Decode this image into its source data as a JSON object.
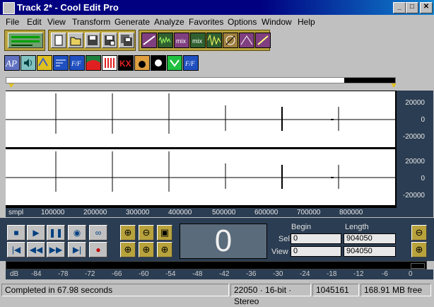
{
  "window": {
    "title": "Track 2* - Cool Edit Pro",
    "minimize": "_",
    "maximize": "□",
    "close": "✕"
  },
  "menu": [
    "File",
    "Edit",
    "View",
    "Transform",
    "Generate",
    "Analyze",
    "Favorites",
    "Options",
    "Window",
    "Help"
  ],
  "toolbar_row1": [
    {
      "icon": "multitrack-view-icon"
    },
    {
      "icon": "new-file-icon"
    },
    {
      "icon": "open-file-icon"
    },
    {
      "icon": "save-icon"
    },
    {
      "icon": "save-as-icon"
    },
    {
      "icon": "save-all-icon"
    },
    {
      "icon": "amplify-icon"
    },
    {
      "icon": "noise-icon"
    },
    {
      "icon": "mix-icon"
    },
    {
      "icon": "mix-2-icon"
    },
    {
      "icon": "waveform-icon"
    },
    {
      "icon": "filter-icon"
    },
    {
      "icon": "envelope-icon"
    },
    {
      "icon": "effect-icon"
    }
  ],
  "toolbar_row2": [
    {
      "icon": "ap-icon",
      "label": "AP"
    },
    {
      "icon": "speaker-icon"
    },
    {
      "icon": "echo-icon"
    },
    {
      "icon": "flanger-icon"
    },
    {
      "icon": "stretch-icon"
    },
    {
      "icon": "red-graph-icon"
    },
    {
      "icon": "stripes-icon"
    },
    {
      "icon": "kx-icon",
      "label": "KX"
    },
    {
      "icon": "pitch-icon"
    },
    {
      "icon": "moon-icon"
    },
    {
      "icon": "green-arrows-icon"
    },
    {
      "icon": "ff-icon"
    }
  ],
  "scale": {
    "top": [
      "20000",
      "0",
      "-20000"
    ],
    "bottom": [
      "20000",
      "0",
      "-20000"
    ]
  },
  "ruler": {
    "unit": "smpl",
    "ticks": [
      "100000",
      "200000",
      "300000",
      "400000",
      "500000",
      "600000",
      "700000",
      "800000"
    ]
  },
  "transport": {
    "stop": "■",
    "play": "▶",
    "pause": "❚❚",
    "play_to_end": "◉",
    "loop": "∞",
    "go_start": "|◀",
    "rewind": "◀◀",
    "forward": "▶▶",
    "go_end": "▶|",
    "record": "●"
  },
  "zoom": {
    "zoom_in": "⊕",
    "zoom_out": "⊖",
    "zoom_full": "▣",
    "zoom_in_left": "⊕",
    "zoom_in_right": "⊕",
    "zoom_sel": "⊕",
    "zoom_in_v": "⊕",
    "zoom_out_v": "⊖"
  },
  "time_display": "0",
  "selection": {
    "begin_header": "Begin",
    "length_header": "Length",
    "sel_label": "Sel",
    "view_label": "View",
    "sel_begin": "0",
    "sel_length": "904050",
    "view_begin": "0",
    "view_length": "904050"
  },
  "level_meter": {
    "ticks": [
      "dB",
      "-84",
      "-78",
      "-72",
      "-66",
      "-60",
      "-54",
      "-48",
      "-42",
      "-36",
      "-30",
      "-24",
      "-18",
      "-12",
      "-6",
      "0"
    ]
  },
  "status": {
    "message": "Completed in 67.98 seconds",
    "format": "22050 · 16-bit · Stereo",
    "size": "1045161",
    "free": "168.91 MB free"
  },
  "colors": {
    "title_bg": "#000080",
    "panel_bg": "#2b3d52",
    "toolbar_gold": "#b8a23c",
    "window_bg": "#c0c0c0"
  }
}
